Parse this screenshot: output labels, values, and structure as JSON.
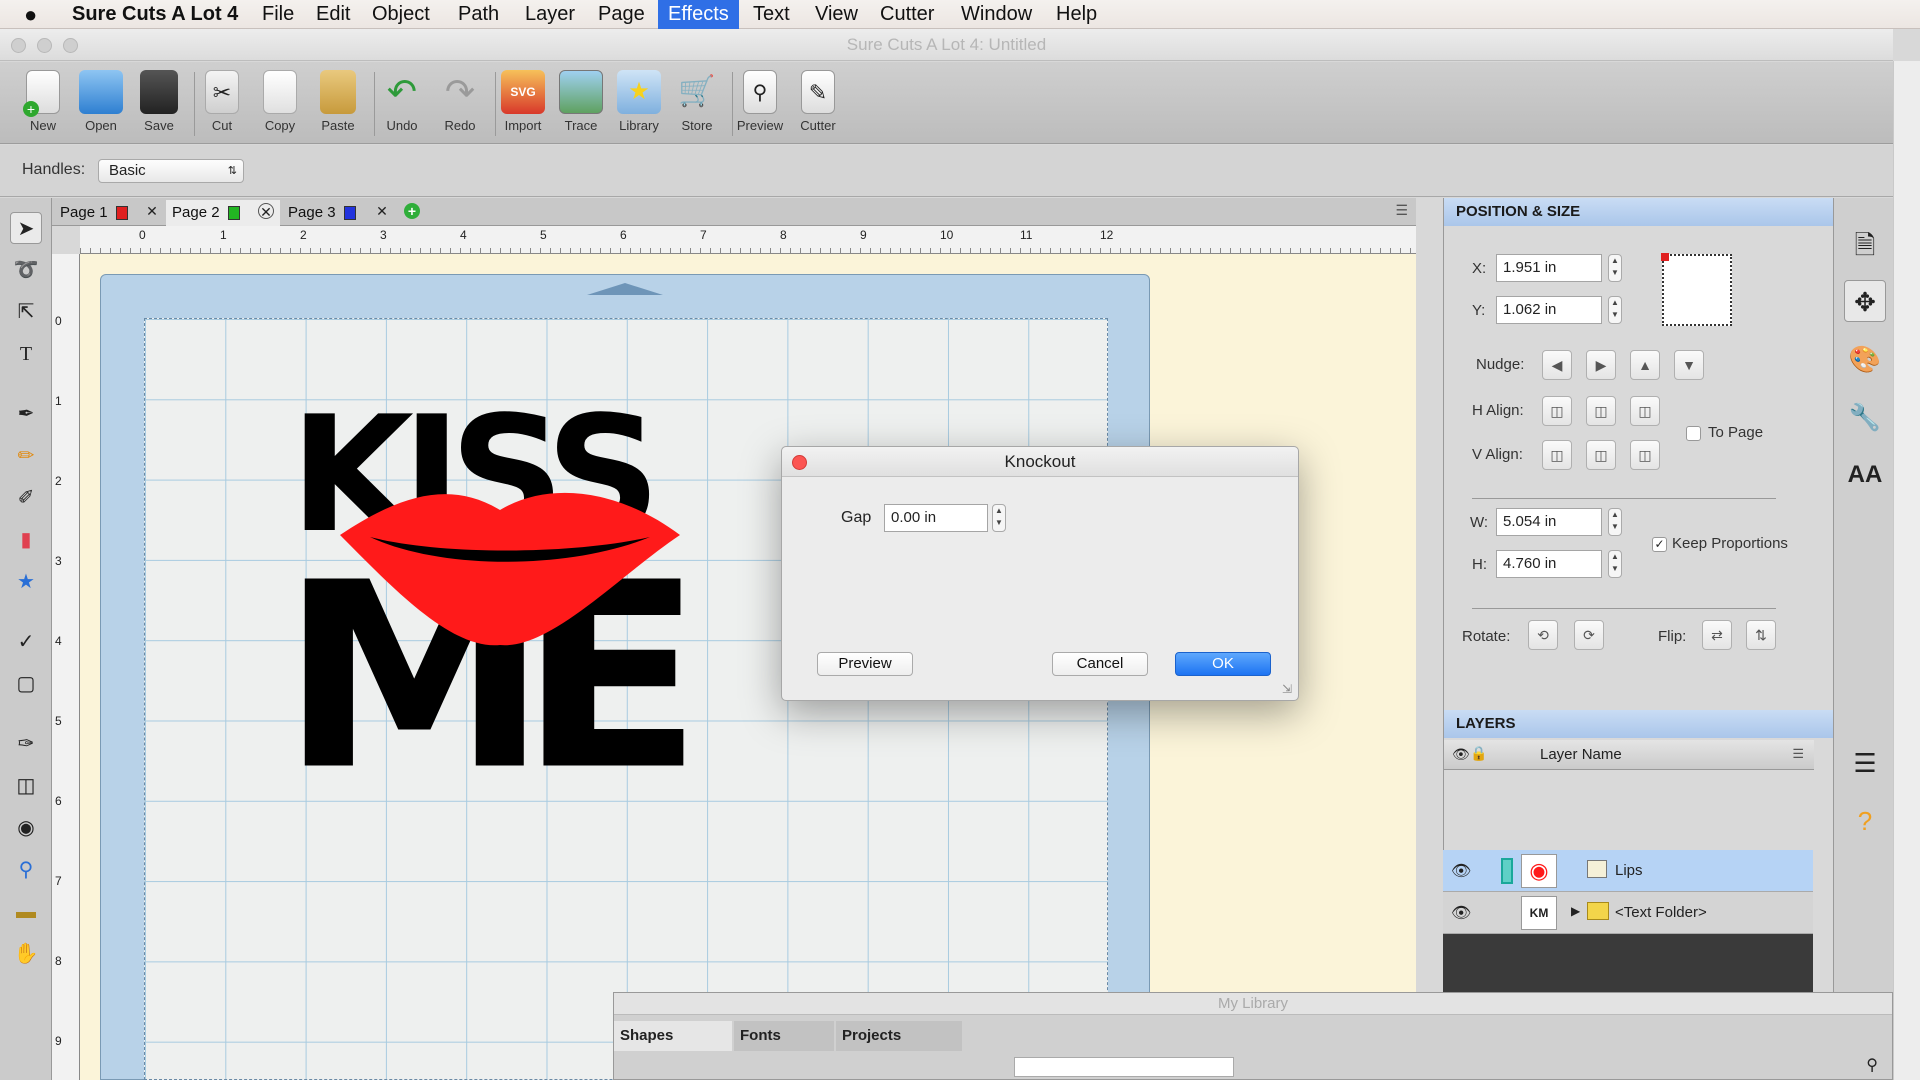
{
  "menubar": {
    "apple": "",
    "app_name": "Sure Cuts A Lot 4",
    "items": [
      "File",
      "Edit",
      "Object",
      "Path",
      "Layer",
      "Page",
      "Effects",
      "Text",
      "View",
      "Cutter",
      "Window",
      "Help"
    ],
    "active": "Effects"
  },
  "window": {
    "title": "Sure Cuts A Lot 4: Untitled"
  },
  "toolbar": {
    "new": "New",
    "open": "Open",
    "save": "Save",
    "cut": "Cut",
    "copy": "Copy",
    "paste": "Paste",
    "undo": "Undo",
    "redo": "Redo",
    "import": "Import",
    "trace": "Trace",
    "library": "Library",
    "store": "Store",
    "preview": "Preview",
    "cutter": "Cutter"
  },
  "handles": {
    "label": "Handles:",
    "value": "Basic"
  },
  "pages": [
    {
      "label": "Page 1",
      "color": "#e02020"
    },
    {
      "label": "Page 2",
      "color": "#22b522"
    },
    {
      "label": "Page 3",
      "color": "#2233dd"
    }
  ],
  "ruler": {
    "ticks": [
      "0",
      "1",
      "2",
      "3",
      "4",
      "5",
      "6",
      "7",
      "8",
      "9",
      "10",
      "11",
      "12"
    ],
    "vticks": [
      "0",
      "1",
      "2",
      "3",
      "4",
      "5",
      "6",
      "7",
      "8",
      "9"
    ]
  },
  "dialog": {
    "title": "Knockout",
    "gap_label": "Gap",
    "gap_value": "0.00 in",
    "preview": "Preview",
    "cancel": "Cancel",
    "ok": "OK"
  },
  "position_size": {
    "header": "POSITION & SIZE",
    "x_label": "X:",
    "x_value": "1.951 in",
    "y_label": "Y:",
    "y_value": "1.062 in",
    "nudge_label": "Nudge:",
    "halign_label": "H Align:",
    "valign_label": "V Align:",
    "to_page": "To Page",
    "w_label": "W:",
    "w_value": "5.054 in",
    "h_label": "H:",
    "h_value": "4.760 in",
    "keep_proportions": "Keep Proportions",
    "rotate_label": "Rotate:",
    "flip_label": "Flip:"
  },
  "layers": {
    "header": "LAYERS",
    "column": "Layer Name",
    "rows": [
      {
        "name": "Lips",
        "selected": true
      },
      {
        "name": "<Text Folder>",
        "selected": false
      }
    ]
  },
  "artwork": {
    "line1": "KISS",
    "line2": "ME"
  },
  "library": {
    "title": "My Library",
    "tabs": [
      "Shapes",
      "Fonts",
      "Projects"
    ]
  },
  "colors": {
    "accent": "#2f6fe6",
    "lips": "#ff1a1a",
    "mat": "#b8d2e8",
    "canvas_bg": "#fbf4d9"
  }
}
